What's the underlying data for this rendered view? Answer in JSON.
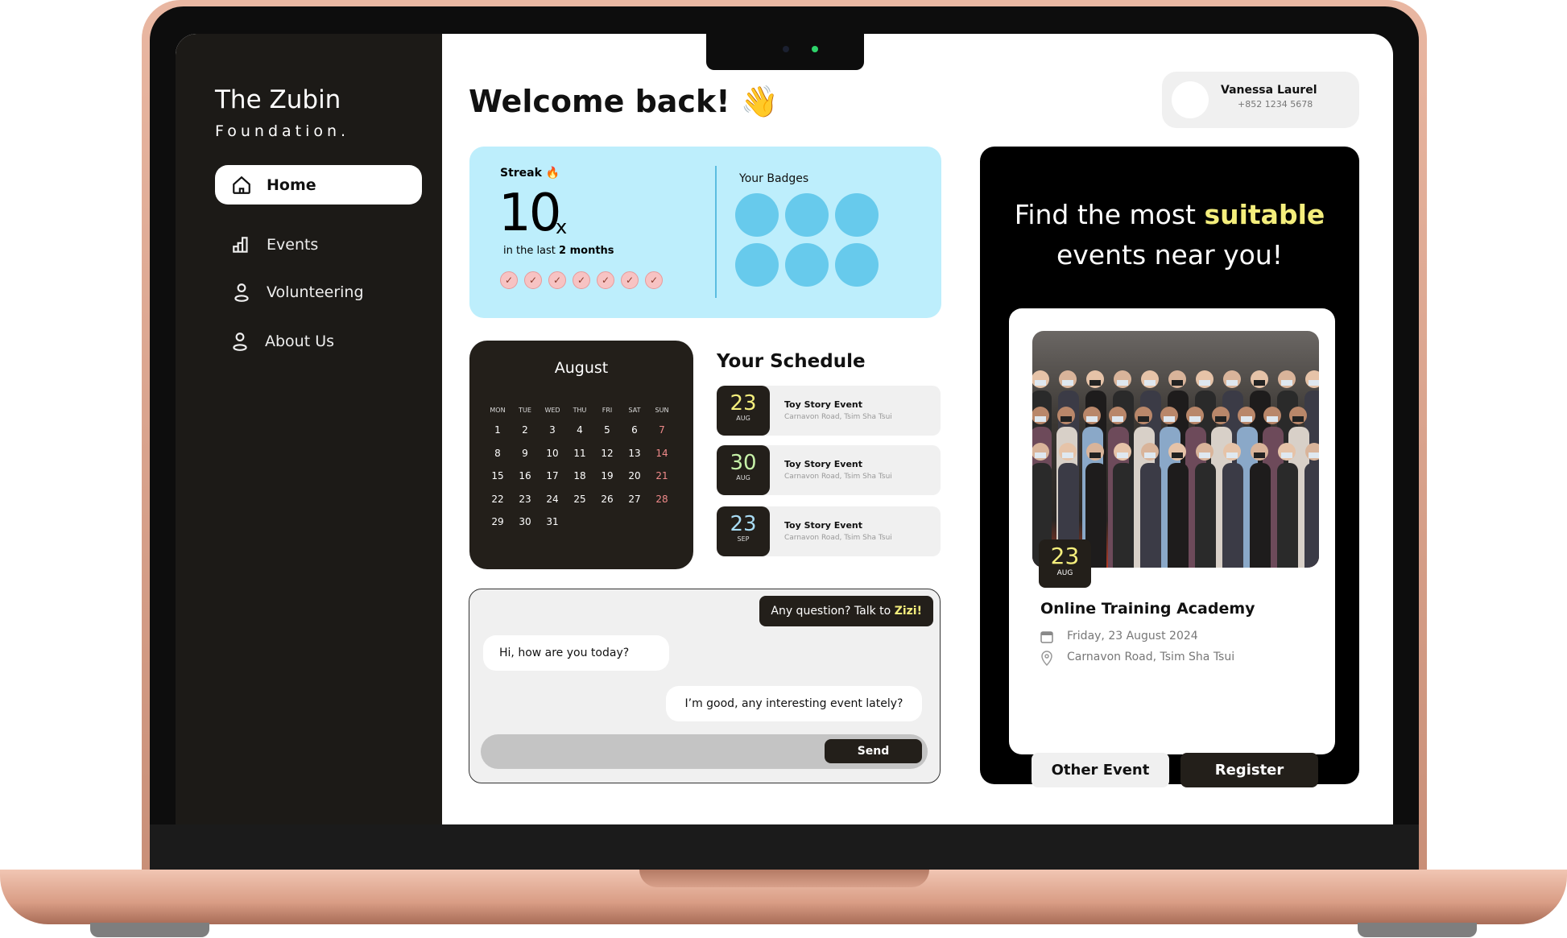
{
  "sidebar": {
    "logo_line1": "The Zubin",
    "logo_line2": "Foundation.",
    "items": [
      {
        "label": "Home",
        "icon": "home-icon",
        "active": true
      },
      {
        "label": "Events",
        "icon": "bar-chart-icon"
      },
      {
        "label": "Volunteering",
        "icon": "user-icon"
      },
      {
        "label": "About Us",
        "icon": "user-icon"
      }
    ]
  },
  "header": {
    "welcome": "Welcome back! 👋",
    "user_name": "Vanessa Laurel",
    "user_phone": "+852 1234 5678"
  },
  "streak": {
    "label": "Streak 🔥",
    "count": "10",
    "suffix": "x",
    "period_prefix": "in the last ",
    "period_bold": "2 months",
    "checks": 7,
    "badges_title": "Your Badges",
    "badge_count": 6,
    "badge_color": "#67caec"
  },
  "calendar": {
    "month": "August",
    "weekdays": [
      "MON",
      "TUE",
      "WED",
      "THU",
      "FRI",
      "SAT",
      "SUN"
    ],
    "days": 31,
    "start_weekday": 0
  },
  "schedule": {
    "title": "Your Schedule",
    "items": [
      {
        "day": "23",
        "month": "AUG",
        "name": "Toy Story Event",
        "location": "Carnavon Road, Tsim Sha Tsui",
        "color": "#f4ee7c"
      },
      {
        "day": "30",
        "month": "AUG",
        "name": "Toy Story Event",
        "location": "Carnavon Road, Tsim Sha Tsui",
        "color": "#c6f1a8"
      },
      {
        "day": "23",
        "month": "SEP",
        "name": "Toy Story Event",
        "location": "Carnavon Road, Tsim Sha Tsui",
        "color": "#a8dcf4"
      }
    ]
  },
  "chat": {
    "header_prefix": "Any question? Talk to ",
    "header_name": "Zizi!",
    "msg_in": "Hi, how are you today?",
    "msg_out": "I’m good, any interesting event lately?",
    "input_placeholder": "",
    "send": "Send"
  },
  "promo": {
    "title_pre": "Find the most ",
    "title_highlight": "suitable",
    "title_post": "events near you!",
    "event_day": "23",
    "event_month": "AUG",
    "event_title": "Online Training Academy",
    "event_date": "Friday, 23 August 2024",
    "event_location": "Carnavon Road, Tsim Sha Tsui",
    "other_button": "Other Event",
    "register_button": "Register"
  },
  "colors": {
    "accent_yellow": "#f4ee7c",
    "dark": "#231f1a",
    "streak_bg": "#bdeefc",
    "weekend_red": "#f08a8a"
  }
}
